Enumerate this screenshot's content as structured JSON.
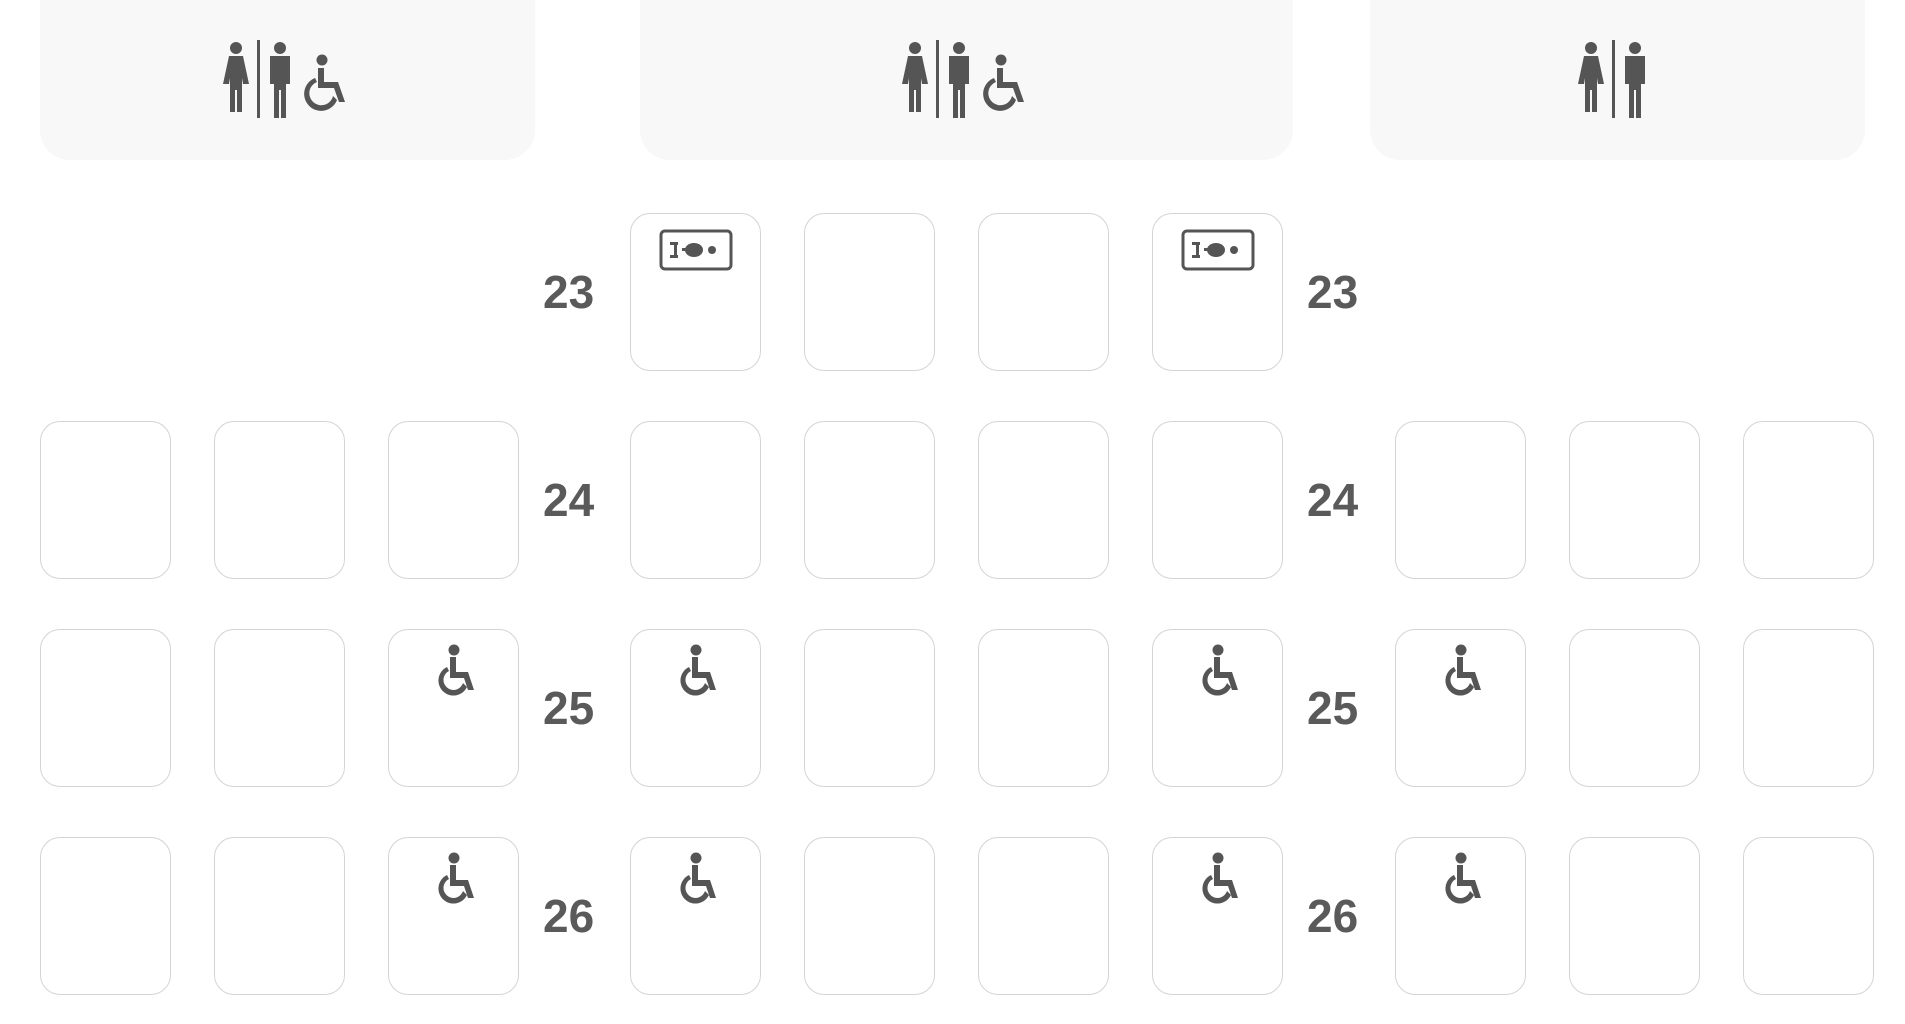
{
  "facilities": [
    {
      "name": "lavatory-left",
      "icons": [
        "woman-icon",
        "man-icon",
        "wheelchair-icon"
      ]
    },
    {
      "name": "lavatory-center",
      "icons": [
        "woman-icon",
        "man-icon",
        "wheelchair-icon"
      ]
    },
    {
      "name": "lavatory-right",
      "icons": [
        "woman-icon",
        "man-icon"
      ]
    }
  ],
  "rows": [
    {
      "label": "23",
      "seats": [
        "none",
        "none",
        "none",
        "bassinet",
        "empty",
        "empty",
        "bassinet",
        "none",
        "none",
        "none"
      ]
    },
    {
      "label": "24",
      "seats": [
        "empty",
        "empty",
        "empty",
        "empty",
        "empty",
        "empty",
        "empty",
        "empty",
        "empty",
        "empty"
      ]
    },
    {
      "label": "25",
      "seats": [
        "empty",
        "empty",
        "wheelchair",
        "wheelchair",
        "empty",
        "empty",
        "wheelchair",
        "wheelchair",
        "empty",
        "empty"
      ]
    },
    {
      "label": "26",
      "seats": [
        "empty",
        "empty",
        "wheelchair",
        "wheelchair",
        "empty",
        "empty",
        "wheelchair",
        "wheelchair",
        "empty",
        "empty"
      ]
    }
  ],
  "colors": {
    "icon": "#555555",
    "seat_border": "#d4d4d4",
    "row_label": "#5a5a5a",
    "facility_bg": "#f8f8f8"
  }
}
